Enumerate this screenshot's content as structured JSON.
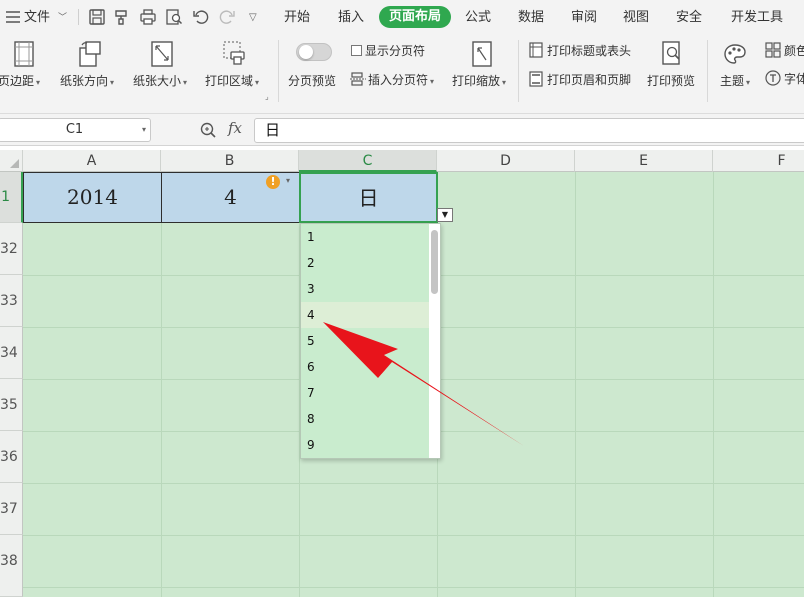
{
  "menu": {
    "file_label": "文件",
    "tabs": [
      "开始",
      "插入",
      "页面布局",
      "公式",
      "数据",
      "审阅",
      "视图",
      "安全",
      "开发工具"
    ],
    "active_tab": "页面布局"
  },
  "ribbon": {
    "margins": "页边距",
    "orientation": "纸张方向",
    "paper_size": "纸张大小",
    "print_area": "打印区域",
    "page_break_preview": "分页预览",
    "show_page_break": "显示分页符",
    "insert_page_break": "插入分页符",
    "print_scale": "打印缩放",
    "print_titles": "打印标题或表头",
    "header_footer": "打印页眉和页脚",
    "print_preview": "打印预览",
    "theme": "主题",
    "color": "颜色",
    "font": "字体"
  },
  "formula_bar": {
    "cell_ref": "C1",
    "fx_label": "fx",
    "content": "日"
  },
  "sheet": {
    "columns": [
      "A",
      "B",
      "C",
      "D",
      "E",
      "F"
    ],
    "active_column": "C",
    "rows": [
      "1",
      "32",
      "33",
      "34",
      "35",
      "36",
      "37",
      "38"
    ],
    "cells": {
      "A1": "2014",
      "B1": "4",
      "C1": "日"
    },
    "warning_glyph": "!",
    "dropdown_options": [
      "1",
      "2",
      "3",
      "4",
      "5",
      "6",
      "7",
      "8",
      "9"
    ],
    "highlighted_option": "4"
  },
  "colors": {
    "accent": "#2fa84f",
    "sheet_bg": "#cde8cf",
    "selected_cell_bg": "#bed7ea",
    "arrow": "#e8141b"
  }
}
